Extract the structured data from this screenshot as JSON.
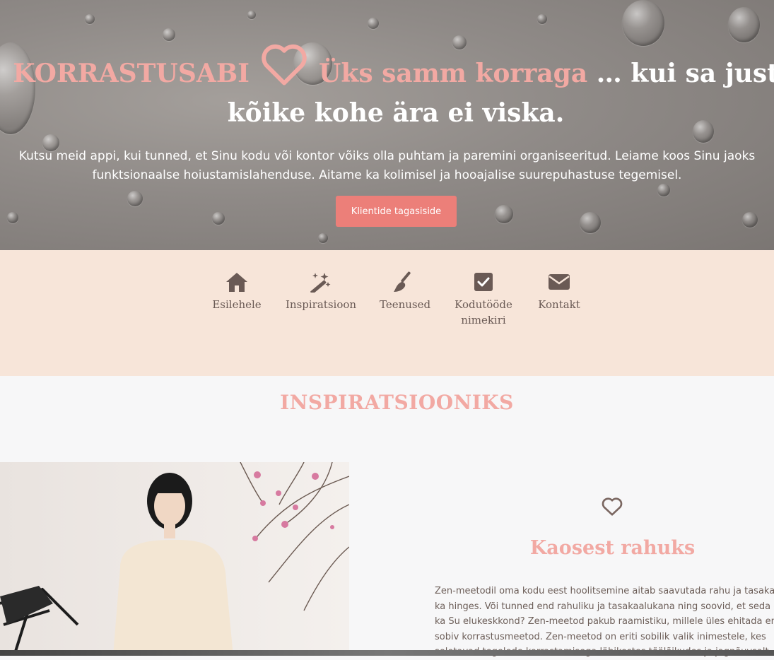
{
  "hero": {
    "brand": "KORRASTUSABI",
    "tagline": "Üks samm korraga",
    "title_rest": " … kui sa just kõike kohe ära ei viska.",
    "description": "Kutsu meid appi, kui tunned, et Sinu kodu või kontor võiks olla puhtam ja paremini organiseeritud. Leiame koos Sinu jaoks funktsionaalse hoiustamislahenduse. Aitame ka kolimisel ja hooajalise suurepuhastuse tegemisel.",
    "button_label": "Klientide tagasiside"
  },
  "nav": {
    "items": [
      {
        "label": "Esilehele",
        "icon": "home-icon"
      },
      {
        "label": "Inspiratsioon",
        "icon": "magic-wand-icon"
      },
      {
        "label": "Teenused",
        "icon": "broom-icon"
      },
      {
        "label": "Kodutööde nimekiri",
        "icon": "checkbox-icon"
      },
      {
        "label": "Kontakt",
        "icon": "envelope-icon"
      }
    ]
  },
  "inspiration": {
    "section_title": "INSPIRATSIOONIKS",
    "card": {
      "icon": "heart-outline-icon",
      "title": "Kaosest rahuks",
      "lines": [
        "Zen-meetodil oma kodu eest hoolitsemine aitab saavutada rahu ja tasakaalu",
        "ka hinges. Või tunned end rahuliku ja tasakaalukana ning soovid, et seda oleks",
        "ka Su elukeskkond? Zen-meetod pakub raamistiku, millele üles ehitada endale",
        "sobiv korrastusmeetod. Zen-meetod on eriti sobilik valik inimestele, kes",
        "seletavad tegelede korrastamisega läbikostes töölõikudes ja jagnõuvsalt"
      ]
    }
  },
  "colors": {
    "accent_pink": "#f2a9a3",
    "button": "#ec7f79",
    "nav_bg": "#f7e5d9",
    "nav_text": "#6a5a55"
  }
}
